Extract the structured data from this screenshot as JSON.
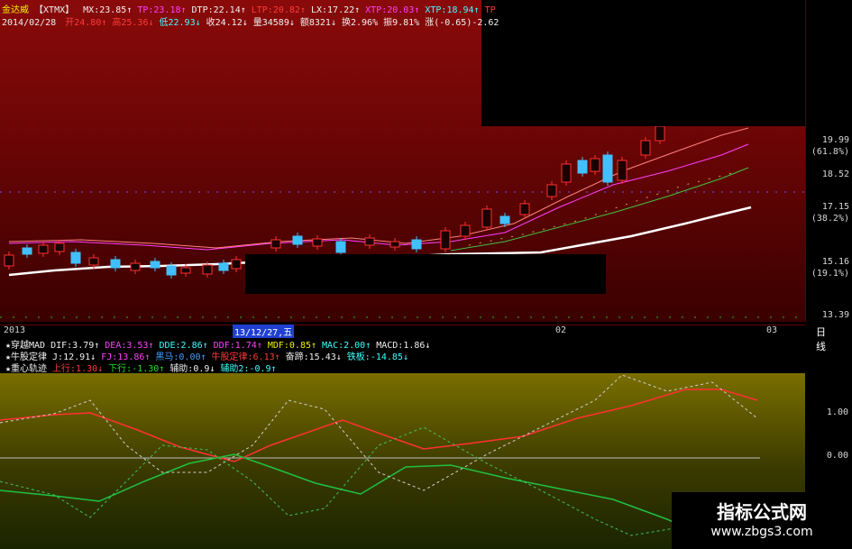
{
  "header": {
    "name": "金达威",
    "code": "【XTMX】",
    "ma_items": [
      {
        "label": "MX:23.85↑",
        "color": "#f0f0f0"
      },
      {
        "label": "TP:23.18↑",
        "color": "#ff40ff"
      },
      {
        "label": "DTP:22.14↑",
        "color": "#f0f0f0"
      },
      {
        "label": "LTP:20.82↑",
        "color": "#ff3b3b"
      },
      {
        "label": "LX:17.22↑",
        "color": "#f0f0f0"
      },
      {
        "label": "XTP:20.03↑",
        "color": "#ff40ff"
      },
      {
        "label": "XTP:18.94↑",
        "color": "#40ffff"
      },
      {
        "label": "TP",
        "color": "#ff3b3b"
      }
    ],
    "date": "2014/02/28",
    "quote_items": [
      {
        "label": "开24.80↑",
        "color": "#ff3b3b"
      },
      {
        "label": "高25.36↓",
        "color": "#ff3b3b"
      },
      {
        "label": "低22.93↓",
        "color": "#40ffff"
      },
      {
        "label": "收24.12↓",
        "color": "#f0f0f0"
      },
      {
        "label": "量34589↓",
        "color": "#f0f0f0"
      },
      {
        "label": "额8321↓",
        "color": "#f0f0f0"
      },
      {
        "label": "换2.96%",
        "color": "#f0f0f0"
      },
      {
        "label": "振9.81%",
        "color": "#f0f0f0"
      },
      {
        "label": "涨(-0.65)-2.62",
        "color": "#f0f0f0"
      }
    ]
  },
  "price_axis": {
    "ticks": [
      "19.99",
      "18.52",
      "17.15",
      "15.16",
      "13.39"
    ],
    "pct": [
      "(61.8%)",
      "(38.2%)",
      "(19.1%)"
    ]
  },
  "date_bar": {
    "year": "2013",
    "cursor_date": "13/12/27,五",
    "month1": "02",
    "month2": "03",
    "period": "日线"
  },
  "indicators": {
    "row1": [
      {
        "label": "★穿越MAD",
        "color": "#f0f0f0"
      },
      {
        "label": "DIF:3.79↑",
        "color": "#f0f0f0"
      },
      {
        "label": "DEA:3.53↑",
        "color": "#ff40ff"
      },
      {
        "label": "DDE:2.86↑",
        "color": "#40ffff"
      },
      {
        "label": "DDF:1.74↑",
        "color": "#ff40ff"
      },
      {
        "label": "MDF:0.85↑",
        "color": "#f0f000"
      },
      {
        "label": "MAC:2.00↑",
        "color": "#40ffff"
      },
      {
        "label": "MACD:1.86↓",
        "color": "#f0f0f0"
      }
    ],
    "row2": [
      {
        "label": "★牛股定律",
        "color": "#f0f0f0"
      },
      {
        "label": "J:12.91↓",
        "color": "#f0f0f0"
      },
      {
        "label": "FJ:13.86↑",
        "color": "#ff40ff"
      },
      {
        "label": "黑马:0.00↑",
        "color": "#40a0ff"
      },
      {
        "label": "牛股定律:6.13↑",
        "color": "#ff3b3b"
      },
      {
        "label": "奋蹄:15.43↓",
        "color": "#f0f0f0"
      },
      {
        "label": "铁板:-14.85↓",
        "color": "#40ffff"
      }
    ],
    "row3": [
      {
        "label": "★重心轨迹",
        "color": "#f0f0f0"
      },
      {
        "label": "上行:1.30↓",
        "color": "#ff3b3b"
      },
      {
        "label": "下行:-1.30↑",
        "color": "#20e020"
      },
      {
        "label": "辅助:0.9↓",
        "color": "#f0f0f0"
      },
      {
        "label": "辅助2:-0.9↑",
        "color": "#40ffff"
      }
    ]
  },
  "lower_axis": {
    "ticks": [
      "1.00",
      "0.00"
    ]
  },
  "watermark": {
    "title": "指标公式网",
    "url": "www.zbgs3.com"
  }
}
